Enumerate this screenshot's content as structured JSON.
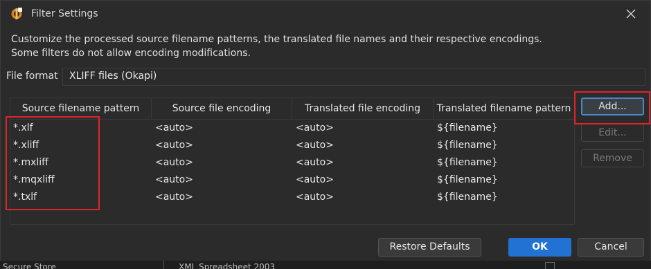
{
  "dialog": {
    "title": "Filter Settings",
    "description_line1": "Customize the processed source filename patterns, the translated file names and their respective encodings.",
    "description_line2": "Some filters do not allow encoding modifications."
  },
  "file_format": {
    "label": "File format",
    "value": "XLIFF files (Okapi)"
  },
  "table": {
    "columns": [
      "Source filename pattern",
      "Source file encoding",
      "Translated file encoding",
      "Translated filename pattern"
    ],
    "rows": [
      [
        "*.xlf",
        "<auto>",
        "<auto>",
        "${filename}"
      ],
      [
        "*.xliff",
        "<auto>",
        "<auto>",
        "${filename}"
      ],
      [
        "*.mxliff",
        "<auto>",
        "<auto>",
        "${filename}"
      ],
      [
        "*.mqxliff",
        "<auto>",
        "<auto>",
        "${filename}"
      ],
      [
        "*.txlf",
        "<auto>",
        "<auto>",
        "${filename}"
      ]
    ]
  },
  "side_buttons": {
    "add": "Add...",
    "edit": "Edit...",
    "remove": "Remove"
  },
  "footer": {
    "restore": "Restore Defaults",
    "ok": "OK",
    "cancel": "Cancel"
  },
  "background": {
    "left_text": "Secure Store",
    "mid_text": "XML Spreadsheet 2003"
  },
  "colors": {
    "accent": "#2172d3",
    "highlight": "#e0242b",
    "dialog_bg": "#2b2b2b"
  },
  "icons": {
    "app": "filter-settings-app-icon",
    "close": "close-icon"
  }
}
